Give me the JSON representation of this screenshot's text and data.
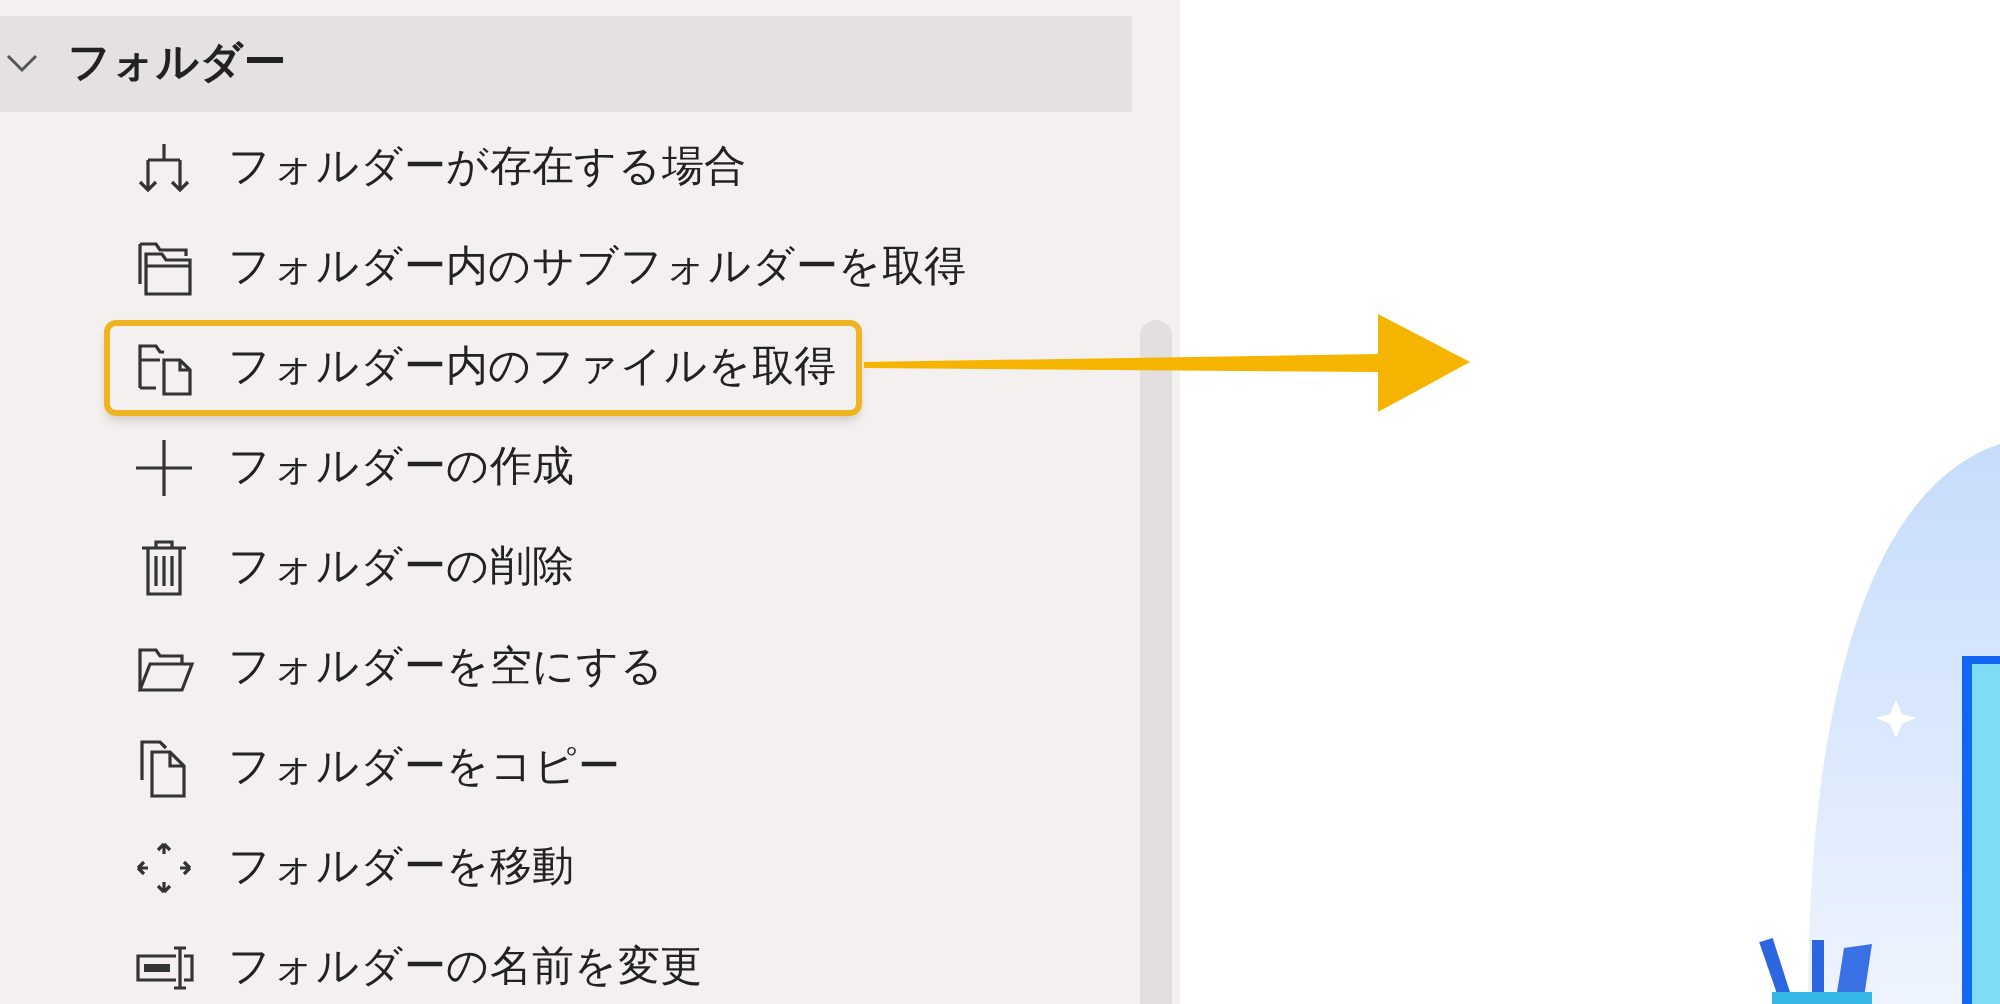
{
  "section": {
    "title": "フォルダー",
    "expanded": true
  },
  "items": [
    {
      "label": "フォルダーが存在する場合",
      "highlighted": false
    },
    {
      "label": "フォルダー内のサブフォルダーを取得",
      "highlighted": false
    },
    {
      "label": "フォルダー内のファイルを取得",
      "highlighted": true
    },
    {
      "label": "フォルダーの作成",
      "highlighted": false
    },
    {
      "label": "フォルダーの削除",
      "highlighted": false
    },
    {
      "label": "フォルダーを空にする",
      "highlighted": false
    },
    {
      "label": "フォルダーをコピー",
      "highlighted": false
    },
    {
      "label": "フォルダーを移動",
      "highlighted": false
    },
    {
      "label": "フォルダーの名前を変更",
      "highlighted": false
    }
  ]
}
